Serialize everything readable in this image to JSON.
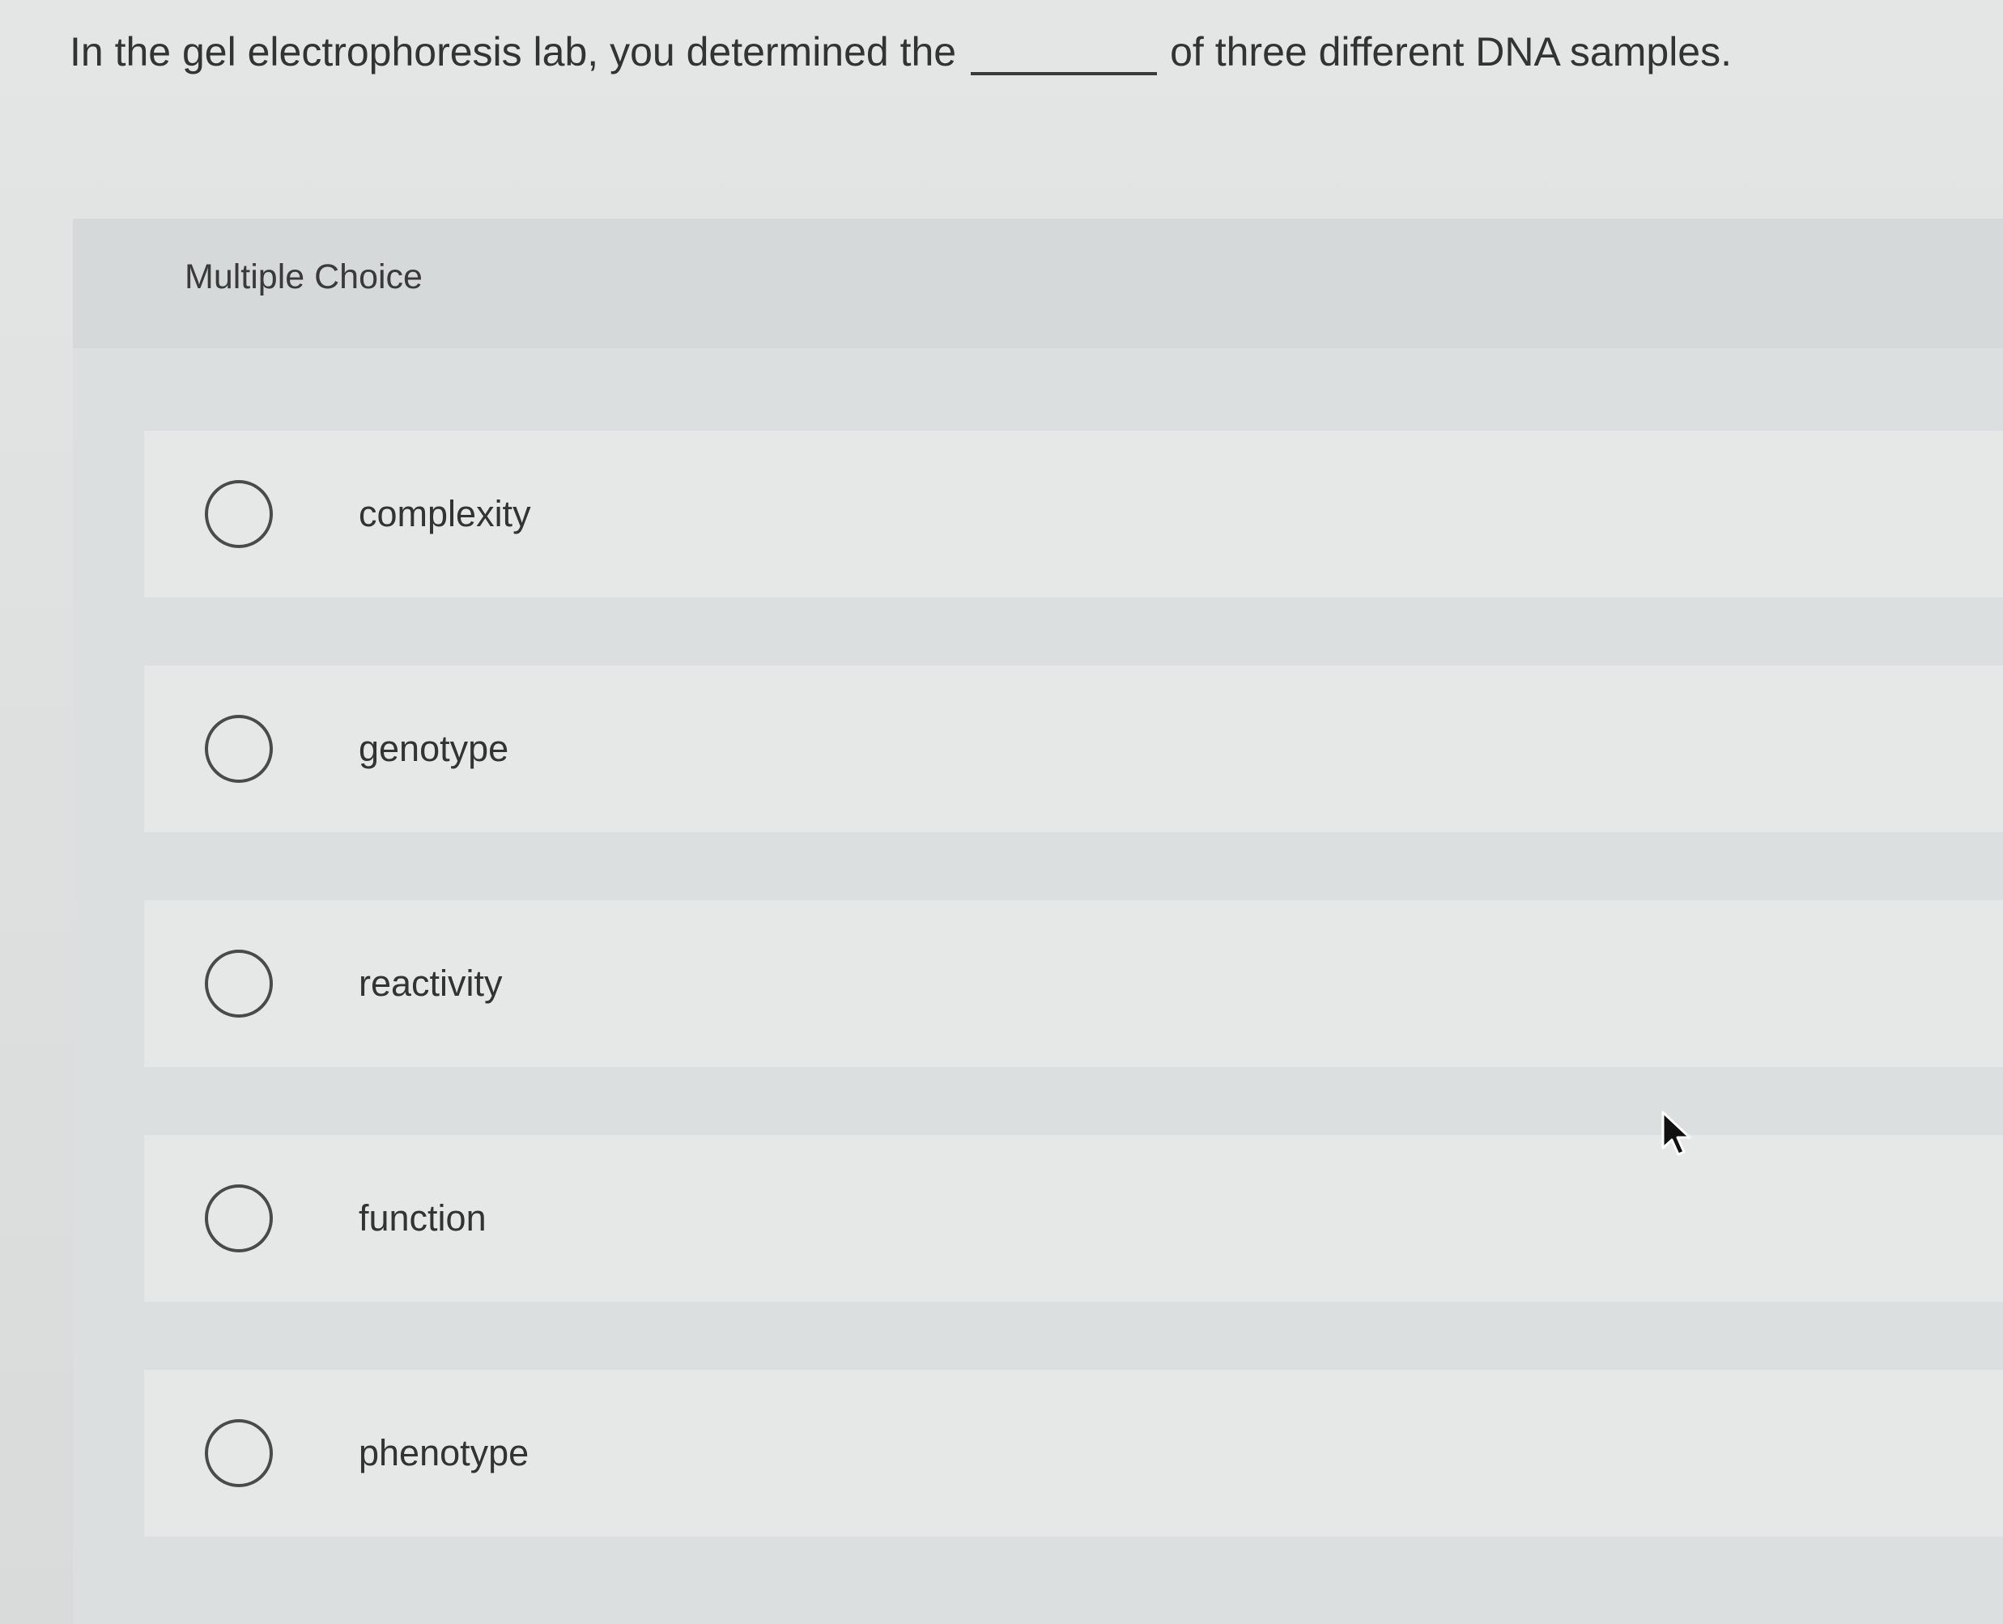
{
  "question": {
    "before_blank": "In the gel electrophoresis lab, you determined the",
    "after_blank": "of three different DNA samples."
  },
  "multiple_choice_label": "Multiple Choice",
  "choices": [
    {
      "label": "complexity",
      "selected": false
    },
    {
      "label": "genotype",
      "selected": false
    },
    {
      "label": "reactivity",
      "selected": false
    },
    {
      "label": "function",
      "selected": false
    },
    {
      "label": "phenotype",
      "selected": false
    }
  ],
  "icons": {
    "radio": "radio-button-unchecked-icon",
    "cursor": "mouse-pointer-icon"
  }
}
